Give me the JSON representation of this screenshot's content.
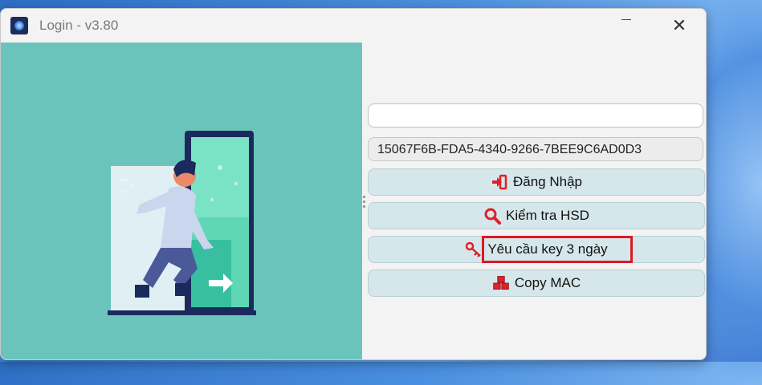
{
  "window": {
    "title": "Login - v3.80",
    "minimize_glyph": "—",
    "close_glyph": "✕"
  },
  "form": {
    "username_value": "",
    "machine_key": "15067F6B-FDA5-4340-9266-7BEE9C6AD0D3"
  },
  "buttons": {
    "login": "Đăng Nhập",
    "check_expiry": "Kiểm tra HSD",
    "request_key": "Yêu cầu key 3 ngày",
    "copy_mac": "Copy MAC"
  },
  "icons": {
    "login": "sign-in-icon",
    "check_expiry": "search-icon",
    "request_key": "key-icon",
    "copy_mac": "cubes-icon"
  },
  "colors": {
    "illustration_bg": "#6bc4bb",
    "button_bg": "#d6e7eb",
    "icon_red": "#e0202a",
    "highlight": "#d81b23"
  }
}
